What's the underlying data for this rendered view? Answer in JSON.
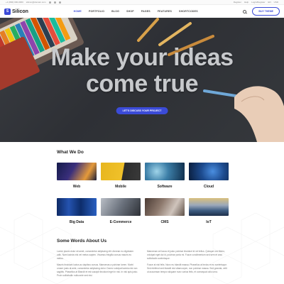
{
  "topbar": {
    "phone": "+1 (800) 000-0000",
    "email": "silicon@domain.com",
    "right_links": [
      "Register",
      "Help",
      "Login/Register"
    ],
    "lang": "EN",
    "currency": "USD"
  },
  "header": {
    "logo_mark": "S",
    "logo_text": "Silicon",
    "nav": [
      "HOME",
      "PORTFOLIO",
      "BLOG",
      "SHOP",
      "PAGES",
      "FEATURES",
      "SHORTCODES"
    ],
    "buy_label": "BUY THEME"
  },
  "hero": {
    "title_line1": "Make your ideas",
    "title_line2": "come true",
    "button_label": "LET'S DISCUSS YOUR PROJECT"
  },
  "what_we_do": {
    "title": "What We Do",
    "items": [
      {
        "label": "Web",
        "thumb": "web-image"
      },
      {
        "label": "Mobile",
        "thumb": "mobile-image"
      },
      {
        "label": "Software",
        "thumb": "software-image"
      },
      {
        "label": "Cloud",
        "thumb": "cloud-image"
      },
      {
        "label": "Big Data",
        "thumb": "big-data-image"
      },
      {
        "label": "E-Commerce",
        "thumb": "ecommerce-image"
      },
      {
        "label": "CMS",
        "thumb": "cms-image"
      },
      {
        "label": "IoT",
        "thumb": "iot-image"
      }
    ]
  },
  "about": {
    "title": "Some Words About Us",
    "col1_p1": "Lorem ipsum dolor sit amet, consectetur adipiscing elit. Aenean eu dignissim odio. Nam lacinia nisl vel metus sapien. Vivamus fringilla cursus mauris eu metus.",
    "col1_p2": "Mauris tincidunt luctus ac dapibus cursus. Maecenas a pulvinar lorem. Morbi ornare justo at ante, consectetur adipiscing dolor. Donec volutpat lacinia nisi non sagittis. Phasellus at Blandit et est suscipit tincidunt eget in nisi. In nisi quis justo. Proin sollicitudin nulla ante sed nisl.",
    "col2_p1": "Maecenas vel lacus et justo pulvinar tincidunt id vel tellus. Quisque orci libero, volutpat eget dui id, pulvinar porta mi. Fusce condimentum sed sem et arcu sollicitudin scelerisque.",
    "col2_p2": "Fusce at nisl felis. Nunc eu blandit massa. Phasellus at lectus et eu scelerisque. Sed eleifend sed blandit nisl ullamcorper, non pulvinar massa. Sed gravida, velit ut accumsan tempor aliquam nunc varius felis, et consequat odio urna."
  }
}
